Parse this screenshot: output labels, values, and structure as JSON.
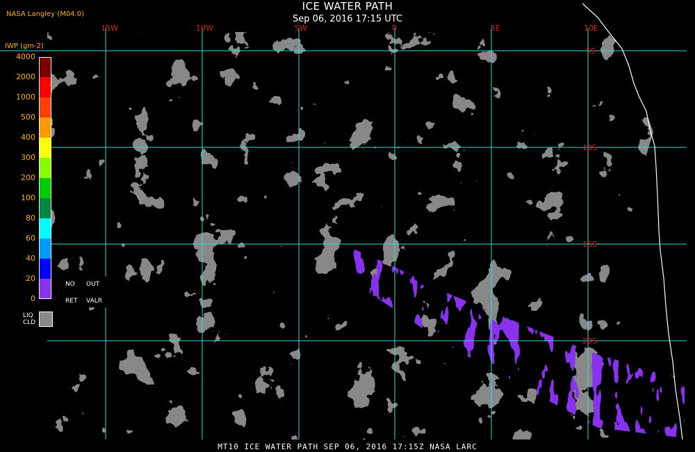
{
  "header": {
    "title": "ICE WATER PATH",
    "subtitle": "Sep 06, 2016 17:15 UTC",
    "source": "NASA Langley (M04.0)"
  },
  "map": {
    "longitude_labels": [
      "15W",
      "10W",
      "5W",
      "0",
      "5E",
      "10E"
    ],
    "latitude_labels": [
      "5S",
      "10S",
      "15S",
      "20S"
    ],
    "colors": {
      "background": "#000000",
      "liquid_cloud": "#888888",
      "gridline": "#33dddd",
      "coastline": "#ffffff",
      "label": "#d62020"
    }
  },
  "legend": {
    "unit_label": "IWP (gm-2)",
    "ticks": [
      "4000",
      "2000",
      "1000",
      "500",
      "400",
      "300",
      "200",
      "100",
      "80",
      "60",
      "40",
      "20",
      "0"
    ],
    "colors": [
      "#7a0000",
      "#ff0000",
      "#ff4000",
      "#ff9900",
      "#ffff00",
      "#88ff00",
      "#00cc00",
      "#008844",
      "#00ffff",
      "#0099ff",
      "#0000ff",
      "#8833ee"
    ],
    "no_retrieval": {
      "line1": "NO",
      "line2": "RET"
    },
    "out_of_range": {
      "line1": "OUT",
      "line2": "VALR"
    },
    "liquid_cloud": {
      "line1": "LIQ",
      "line2": "CLD"
    }
  },
  "footer": {
    "text": "MT10  ICE WATER PATH  SEP 06, 2016 17:15Z  NASA LARC"
  }
}
